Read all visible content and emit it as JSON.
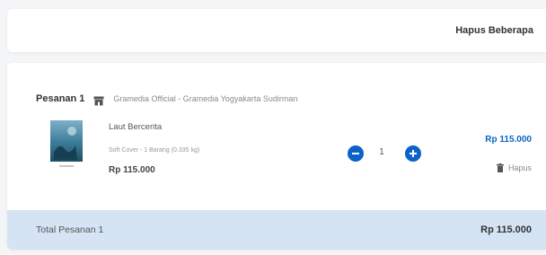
{
  "header": {
    "bulk_delete_label": "Hapus Beberapa"
  },
  "order": {
    "label": "Pesanan 1",
    "store_icon": "store-icon",
    "store_name": "Gramedia Official - Gramedia Yogyakarta Sudirman",
    "item": {
      "title": "Laut Bercerita",
      "meta": "Soft Cover - 1 Barang (0.335 kg)",
      "price": "Rp 115.000",
      "quantity": "1",
      "line_total": "Rp 115.000",
      "delete_label": "Hapus"
    },
    "total_label": "Total Pesanan 1",
    "total_value": "Rp 115.000"
  },
  "colors": {
    "accent": "#0b63c9",
    "total_bar": "#d4e4f4",
    "background": "#f4f5f7"
  }
}
